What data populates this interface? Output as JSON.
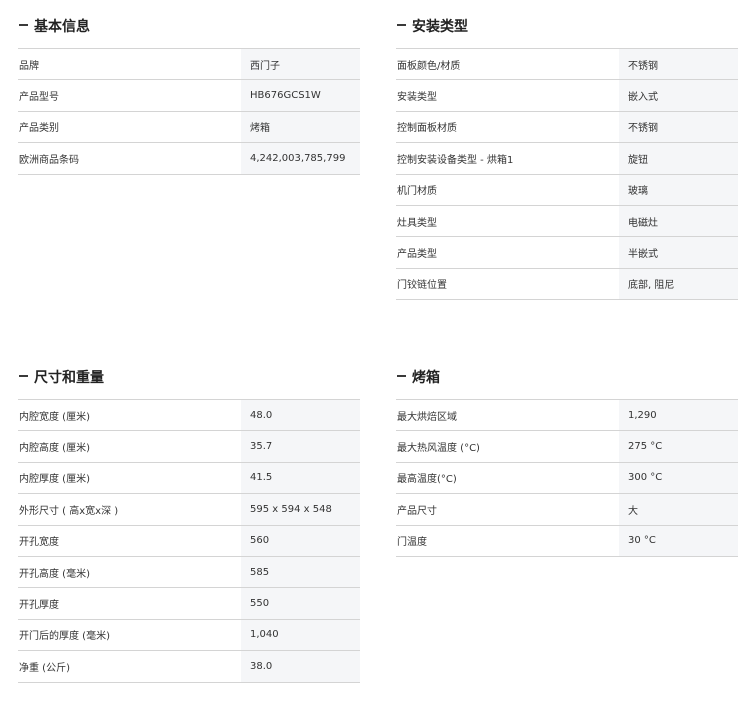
{
  "sections": {
    "basic": {
      "title": "基本信息",
      "rows": [
        {
          "label": "品牌",
          "value": "西门子"
        },
        {
          "label": "产品型号",
          "value": "HB676GCS1W"
        },
        {
          "label": "产品类别",
          "value": "烤箱"
        },
        {
          "label": "欧洲商品条码",
          "value": "4,242,003,785,799"
        }
      ]
    },
    "install": {
      "title": "安装类型",
      "rows": [
        {
          "label": "面板颜色/材质",
          "value": "不锈钢"
        },
        {
          "label": "安装类型",
          "value": "嵌入式"
        },
        {
          "label": "控制面板材质",
          "value": "不锈钢"
        },
        {
          "label": "控制安装设备类型 - 烘箱1",
          "value": "旋钮"
        },
        {
          "label": "机门材质",
          "value": "玻璃"
        },
        {
          "label": "灶具类型",
          "value": "电磁灶"
        },
        {
          "label": "产品类型",
          "value": "半嵌式"
        },
        {
          "label": "门铰链位置",
          "value": "底部, 阻尼"
        }
      ]
    },
    "dims": {
      "title": "尺寸和重量",
      "rows": [
        {
          "label": "内腔宽度 (厘米)",
          "value": "48.0"
        },
        {
          "label": "内腔高度 (厘米)",
          "value": "35.7"
        },
        {
          "label": "内腔厚度 (厘米)",
          "value": "41.5"
        },
        {
          "label": "外形尺寸 ( 高x宽x深 )",
          "value": "595 x 594 x 548"
        },
        {
          "label": "开孔宽度",
          "value": "560"
        },
        {
          "label": "开孔高度 (毫米)",
          "value": "585"
        },
        {
          "label": "开孔厚度",
          "value": "550"
        },
        {
          "label": "开门后的厚度 (毫米)",
          "value": "1,040"
        },
        {
          "label": "净重 (公斤)",
          "value": "38.0"
        }
      ]
    },
    "oven": {
      "title": "烤箱",
      "rows": [
        {
          "label": "最大烘焙区域",
          "value": "1,290"
        },
        {
          "label": "最大热风温度 (°C)",
          "value": "275 °C"
        },
        {
          "label": "最高温度(°C)",
          "value": "300 °C"
        },
        {
          "label": "产品尺寸",
          "value": "大"
        },
        {
          "label": "门温度",
          "value": "30 °C"
        }
      ]
    }
  }
}
